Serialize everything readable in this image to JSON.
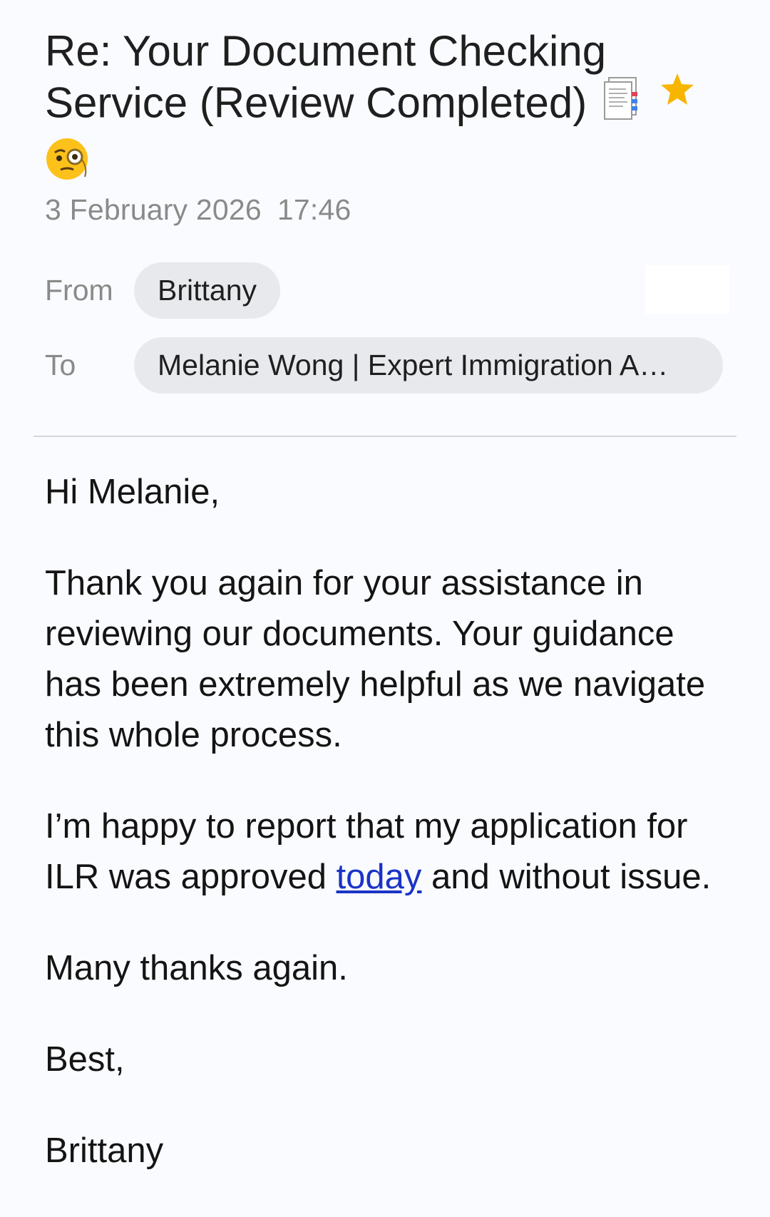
{
  "email": {
    "subject": "Re: Your Document Checking Service (Review Completed)",
    "subject_emojis": [
      "bookmark-tabs-icon",
      "face-with-monocle-icon"
    ],
    "starred": true,
    "date": "3 February 2026",
    "time": "17:46",
    "from_label": "From",
    "from_name": "Brittany",
    "to_label": "To",
    "to_name": "Melanie Wong | Expert Immigration A…"
  },
  "body": {
    "greeting": "Hi Melanie,",
    "para1": "Thank you again for your assistance in reviewing our documents. Your guidance has been extremely helpful as we navigate this whole process.",
    "para2_before": "I’m happy to report that my application for ILR was approved ",
    "para2_link": "today",
    "para2_after": " and without issue.",
    "para3": "Many thanks again.",
    "signoff": "Best,",
    "signature": "Brittany"
  },
  "colors": {
    "star": "#f7b500",
    "link": "#1a33c7",
    "chip_bg": "#e8e9ec",
    "muted_text": "#8a8a8a"
  }
}
